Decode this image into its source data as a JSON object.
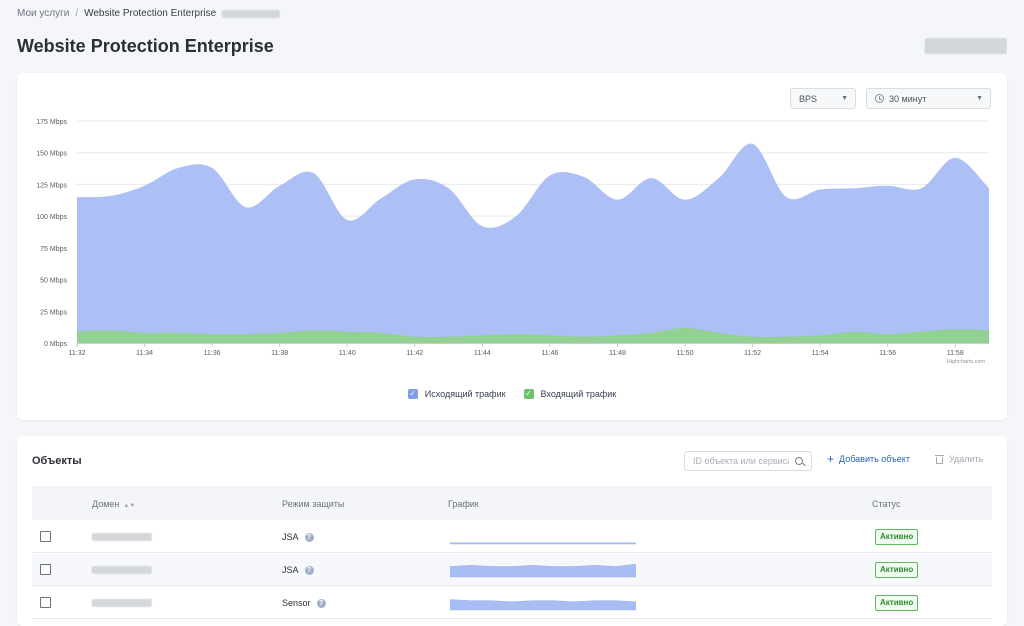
{
  "breadcrumb": {
    "home": "Мои услуги",
    "separator": "/",
    "current": "Website Protection Enterprise"
  },
  "page_title": "Website Protection Enterprise",
  "chart_controls": {
    "metric": "BPS",
    "period": "30 минут"
  },
  "colors": {
    "outgoing": "#a9bdf5",
    "incoming": "#90d28a",
    "accent": "#2563b8",
    "status": "#2e8b2e"
  },
  "chart_data": {
    "type": "area",
    "title": "",
    "xlabel": "",
    "ylabel": "",
    "x_ticks": [
      "11:32",
      "11:34",
      "11:36",
      "11:38",
      "11:40",
      "11:42",
      "11:44",
      "11:46",
      "11:48",
      "11:50",
      "11:52",
      "11:54",
      "11:56",
      "11:58"
    ],
    "y_ticks": [
      "0 Mbps",
      "25 Mbps",
      "50 Mbps",
      "75 Mbps",
      "100 Mbps",
      "125 Mbps",
      "150 Mbps",
      "175 Mbps"
    ],
    "ylim": [
      0,
      175
    ],
    "xlim": [
      0,
      27.0
    ],
    "x_unit": "minutes after 11:32",
    "grid": true,
    "credit": "Highcharts.com",
    "series": [
      {
        "name": "Исходящий трафик",
        "x": [
          0,
          1,
          2,
          3,
          4,
          5,
          6,
          7,
          8,
          9,
          10,
          11,
          12,
          13,
          14,
          15,
          16,
          17,
          18,
          19,
          20,
          21,
          22,
          23,
          24,
          25,
          26,
          27
        ],
        "values": [
          115,
          116,
          124,
          138,
          138,
          107,
          124,
          134,
          97,
          114,
          129,
          122,
          92,
          100,
          132,
          131,
          113,
          130,
          113,
          130,
          157,
          115,
          121,
          122,
          124,
          122,
          146,
          122
        ]
      },
      {
        "name": "Входящий трафик",
        "x": [
          0,
          1,
          2,
          3,
          4,
          5,
          6,
          7,
          8,
          9,
          10,
          11,
          12,
          13,
          14,
          15,
          16,
          17,
          18,
          19,
          20,
          21,
          22,
          23,
          24,
          25,
          26,
          27
        ],
        "values": [
          9,
          10,
          8,
          8,
          7,
          7,
          8,
          10,
          9,
          8,
          5,
          5,
          6,
          7,
          6,
          5,
          6,
          8,
          12,
          8,
          5,
          5,
          6,
          9,
          7,
          9,
          11,
          10
        ]
      }
    ]
  },
  "objects": {
    "title": "Объекты",
    "search_placeholder": "ID объекта или сервиса",
    "add_label": "Добавить объект",
    "delete_label": "Удалить",
    "columns": {
      "domain": "Домен",
      "mode": "Режим защиты",
      "graph": "График",
      "status": "Статус"
    },
    "rows": [
      {
        "mode": "JSA",
        "status": "Активно",
        "spark": [
          1,
          1,
          1,
          1,
          1,
          1,
          1,
          1,
          1,
          1
        ]
      },
      {
        "mode": "JSA",
        "status": "Активно",
        "spark": [
          9,
          10,
          9,
          9,
          10,
          9,
          9,
          10,
          9,
          11
        ]
      },
      {
        "mode": "Sensor",
        "status": "Активно",
        "spark": [
          9,
          8,
          8,
          7,
          8,
          8,
          7,
          8,
          8,
          7
        ]
      }
    ]
  }
}
